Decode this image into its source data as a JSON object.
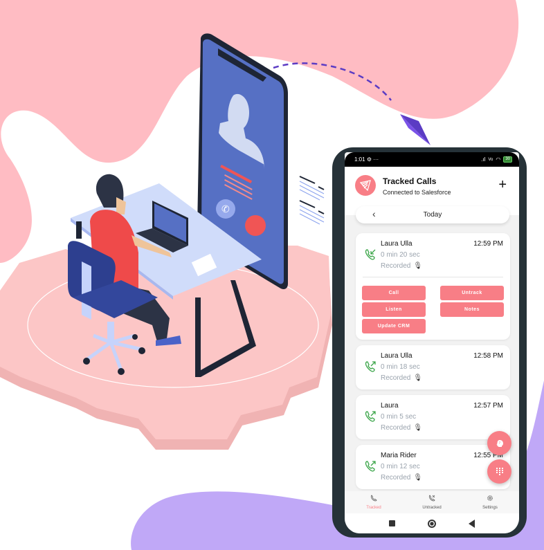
{
  "colors": {
    "accent": "#f87e86",
    "pink_blob": "#ffbcc3",
    "purple_blob": "#c0a8f7",
    "gear": "#fcc6c6",
    "phone_frame": "#263238",
    "call_green": "#3aa548",
    "illus_blue": "#5069c0"
  },
  "status_bar": {
    "time": "1:01",
    "left_icons": "⚙ ···",
    "signal": ".ıl",
    "volte": "Vo",
    "battery": "30"
  },
  "header": {
    "title": "Tracked Calls",
    "subtitle": "Connected to Salesforce",
    "add_label": "+"
  },
  "date_nav": {
    "prev_label": "‹",
    "label": "Today"
  },
  "calls": [
    {
      "name": "Laura Ulla",
      "time": "12:59 PM",
      "duration": "0 min 20 sec",
      "status": "Recorded",
      "direction": "incoming",
      "expanded": true
    },
    {
      "name": "Laura Ulla",
      "time": "12:58 PM",
      "duration": "0 min 18 sec",
      "status": "Recorded",
      "direction": "outgoing"
    },
    {
      "name": "Laura",
      "time": "12:57 PM",
      "duration": "0 min 5 sec",
      "status": "Recorded",
      "direction": "outgoing"
    },
    {
      "name": "Maria Rider",
      "time": "12:55 PM",
      "duration": "0 min 12 sec",
      "status": "Recorded",
      "direction": "outgoing"
    }
  ],
  "actions": {
    "call": "Call",
    "untrack": "Untrack",
    "listen": "Listen",
    "notes": "Notes",
    "update_crm": "Update CRM"
  },
  "bottom_nav": [
    {
      "label": "Tracked",
      "icon": "phone-icon",
      "active": true
    },
    {
      "label": "Untracked",
      "icon": "phone-untracked-icon",
      "active": false
    },
    {
      "label": "Settings",
      "icon": "gear-icon",
      "active": false
    }
  ]
}
